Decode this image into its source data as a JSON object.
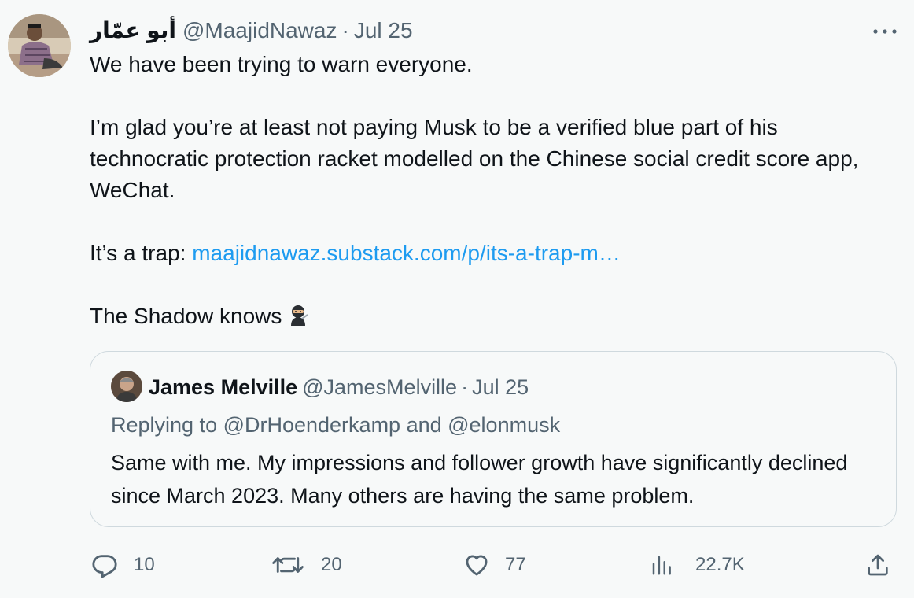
{
  "tweet": {
    "author": {
      "display_name": "أبو عمّار",
      "handle": "@MaajidNawaz",
      "separator": "·",
      "date": "Jul 25"
    },
    "more_icon": "more-horizontal-icon",
    "lines": {
      "line1": "We have been trying to warn everyone.",
      "line2": "I’m glad you’re at least not paying Musk to be a verified blue part of his technocratic protection racket modelled on the Chinese social credit score app, WeChat.",
      "line3_prefix": "It’s a trap: ",
      "line3_link": "maajidnawaz.substack.com/p/its-a-trap-m…",
      "line4": "The Shadow knows",
      "line4_emoji": "ninja-emoji"
    },
    "quoted": {
      "display_name": "James Melville",
      "handle": "@JamesMelville",
      "separator": "·",
      "date": "Jul 25",
      "replying_to": "Replying to @DrHoenderkamp and @elonmusk",
      "text": "Same with me. My impressions and follower growth have significantly declined since March 2023. Many others are having the same problem."
    },
    "actions": {
      "reply": {
        "icon": "reply-icon",
        "count": "10"
      },
      "retweet": {
        "icon": "retweet-icon",
        "count": "20"
      },
      "like": {
        "icon": "heart-icon",
        "count": "77"
      },
      "views": {
        "icon": "views-icon",
        "count": "22.7K"
      },
      "share": {
        "icon": "share-icon"
      }
    },
    "colors": {
      "background": "#f7f9f9",
      "text": "#0f1419",
      "secondary": "#536471",
      "link": "#1d9bf0",
      "border": "#cfd9de"
    }
  }
}
